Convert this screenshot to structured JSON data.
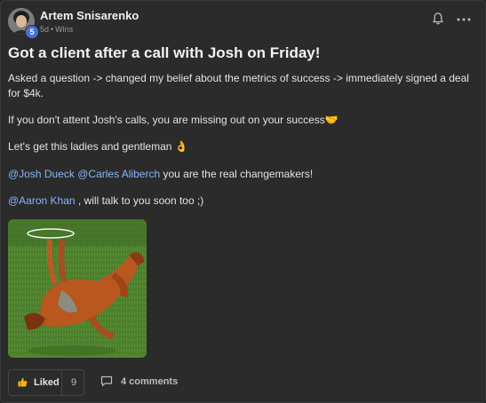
{
  "post": {
    "author": {
      "name": "Artem Snisarenko",
      "level": "5",
      "time": "5d",
      "category": "Wins"
    },
    "title": "Got a client after a call with Josh on Friday!",
    "body": {
      "line1": "Asked a question -> changed my belief about the metrics of success -> immediately signed a deal for $4k.",
      "line2": "If you don't attent Josh's calls, you are missing out on your success",
      "line2_emoji": "🤝",
      "line3": "Let's get this ladies and gentleman",
      "line3_emoji": "👌",
      "mention1": "@Josh Dueck",
      "mention2": "@Carles Aliberch",
      "line4_rest": " you are the real changemakers!",
      "mention3": "@Aaron Khan",
      "line5_rest": " , will talk to you soon too ;)"
    },
    "image": {
      "icon": "horse-rolling-on-grass-image"
    }
  },
  "actions": {
    "like_label": "Liked",
    "like_count": "9",
    "comments_label": "4 comments"
  },
  "colors": {
    "background": "#2b2b2b",
    "mention": "#8ab4f8",
    "level_badge": "#4a6de0",
    "liked_accent": "#f5b800"
  }
}
